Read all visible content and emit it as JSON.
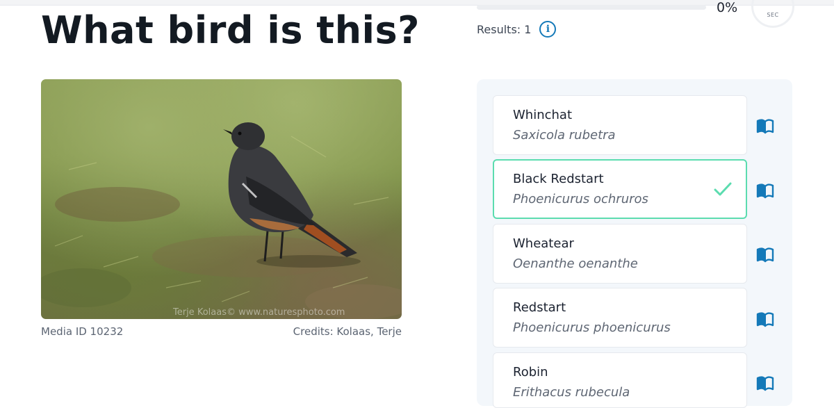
{
  "header": {
    "title": "What bird is this?",
    "progress_percent": "0%",
    "progress_value": 0,
    "timer_unit": "SEC",
    "results_label": "Results: 1",
    "info_icon": "info-icon"
  },
  "media": {
    "image_alt": "black redstart standing on grass",
    "watermark": "Terje Kolaas© www.naturesphoto.com",
    "media_id": "Media ID 10232",
    "credits": "Credits: Kolaas, Terje"
  },
  "options": [
    {
      "common": "Whinchat",
      "scientific": "Saxicola rubetra",
      "selected": false
    },
    {
      "common": "Black Redstart",
      "scientific": "Phoenicurus ochruros",
      "selected": true
    },
    {
      "common": "Wheatear",
      "scientific": "Oenanthe oenanthe",
      "selected": false
    },
    {
      "common": "Redstart",
      "scientific": "Phoenicurus phoenicurus",
      "selected": false
    },
    {
      "common": "Robin",
      "scientific": "Erithacus rubecula",
      "selected": false
    }
  ],
  "colors": {
    "accent_blue": "#1479b8",
    "correct_green": "#5bdcaf",
    "panel_bg": "#f3f7fb"
  }
}
